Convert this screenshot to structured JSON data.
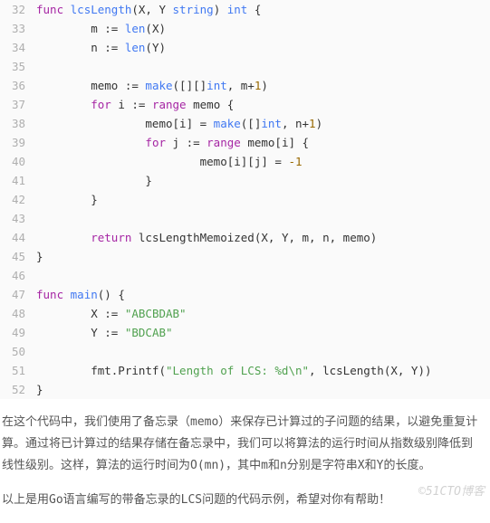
{
  "code": {
    "lines": [
      {
        "n": 32,
        "tokens": [
          [
            "kw",
            "func"
          ],
          [
            " "
          ],
          [
            "fn",
            "lcsLength"
          ],
          [
            "(X, Y "
          ],
          [
            "type",
            "string"
          ],
          [
            ") "
          ],
          [
            "type",
            "int"
          ],
          [
            " {"
          ]
        ]
      },
      {
        "n": 33,
        "tokens": [
          [
            "        m := "
          ],
          [
            "builtin",
            "len"
          ],
          [
            "(X)"
          ]
        ]
      },
      {
        "n": 34,
        "tokens": [
          [
            "        n := "
          ],
          [
            "builtin",
            "len"
          ],
          [
            "(Y)"
          ]
        ]
      },
      {
        "n": 35,
        "tokens": [
          [
            ""
          ]
        ]
      },
      {
        "n": 36,
        "tokens": [
          [
            "        memo := "
          ],
          [
            "builtin",
            "make"
          ],
          [
            "([][]"
          ],
          [
            "type",
            "int"
          ],
          [
            ", m+"
          ],
          [
            "num",
            "1"
          ],
          [
            ")"
          ]
        ]
      },
      {
        "n": 37,
        "tokens": [
          [
            "        "
          ],
          [
            "kw",
            "for"
          ],
          [
            " i := "
          ],
          [
            "kw",
            "range"
          ],
          [
            " memo {"
          ]
        ]
      },
      {
        "n": 38,
        "tokens": [
          [
            "                memo[i] = "
          ],
          [
            "builtin",
            "make"
          ],
          [
            "([]"
          ],
          [
            "type",
            "int"
          ],
          [
            ", n+"
          ],
          [
            "num",
            "1"
          ],
          [
            ")"
          ]
        ]
      },
      {
        "n": 39,
        "tokens": [
          [
            "                "
          ],
          [
            "kw",
            "for"
          ],
          [
            " j := "
          ],
          [
            "kw",
            "range"
          ],
          [
            " memo[i] {"
          ]
        ]
      },
      {
        "n": 40,
        "tokens": [
          [
            "                        memo[i][j] = "
          ],
          [
            "num",
            "-1"
          ]
        ]
      },
      {
        "n": 41,
        "tokens": [
          [
            "                }"
          ]
        ]
      },
      {
        "n": 42,
        "tokens": [
          [
            "        }"
          ]
        ]
      },
      {
        "n": 43,
        "tokens": [
          [
            ""
          ]
        ]
      },
      {
        "n": 44,
        "tokens": [
          [
            "        "
          ],
          [
            "kw",
            "return"
          ],
          [
            " lcsLengthMemoized(X, Y, m, n, memo)"
          ]
        ]
      },
      {
        "n": 45,
        "tokens": [
          [
            "}"
          ]
        ]
      },
      {
        "n": 46,
        "tokens": [
          [
            ""
          ]
        ]
      },
      {
        "n": 47,
        "tokens": [
          [
            "kw",
            "func"
          ],
          [
            " "
          ],
          [
            "fn",
            "main"
          ],
          [
            "() {"
          ]
        ]
      },
      {
        "n": 48,
        "tokens": [
          [
            "        X := "
          ],
          [
            "str",
            "\"ABCBDAB\""
          ]
        ]
      },
      {
        "n": 49,
        "tokens": [
          [
            "        Y := "
          ],
          [
            "str",
            "\"BDCAB\""
          ]
        ]
      },
      {
        "n": 50,
        "tokens": [
          [
            ""
          ]
        ]
      },
      {
        "n": 51,
        "tokens": [
          [
            "        fmt.Printf("
          ],
          [
            "str",
            "\"Length of LCS: %d\\n\""
          ],
          [
            ", lcsLength(X, Y))"
          ]
        ]
      },
      {
        "n": 52,
        "tokens": [
          [
            "}"
          ]
        ]
      }
    ]
  },
  "paragraphs": {
    "p1": "在这个代码中，我们使用了备忘录（memo）来保存已计算过的子问题的结果，以避免重复计算。通过将已计算过的结果存储在备忘录中，我们可以将算法的运行时间从指数级别降低到线性级别。这样，算法的运行时间为O(mn)，其中m和n分别是字符串X和Y的长度。",
    "p2": "以上是用Go语言编写的带备忘录的LCS问题的代码示例，希望对你有帮助！"
  },
  "watermark": "©51CTO博客"
}
